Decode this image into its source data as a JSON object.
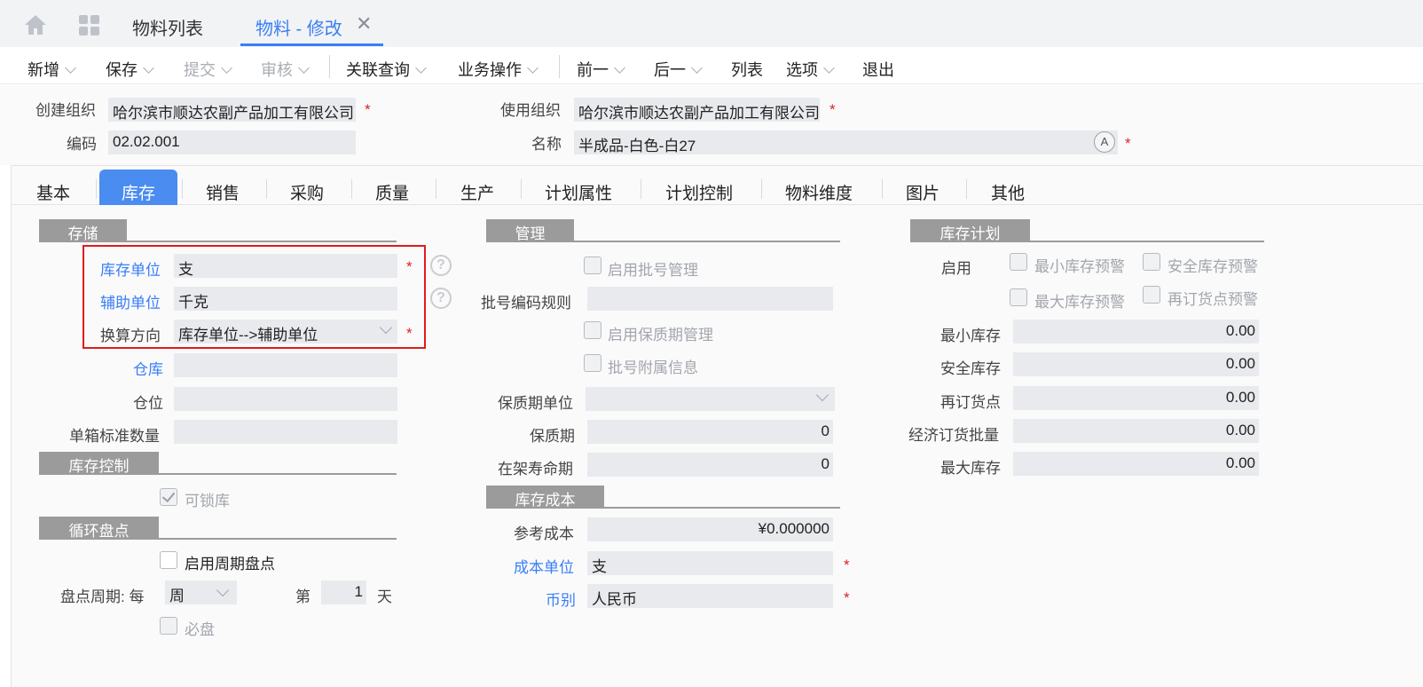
{
  "top_tabs": {
    "list": "物料列表",
    "active": "物料 - 修改",
    "close": "✕"
  },
  "toolbar": {
    "new": "新增",
    "save": "保存",
    "submit": "提交",
    "audit": "审核",
    "related_query": "关联查询",
    "business_ops": "业务操作",
    "prev": "前一",
    "next": "后一",
    "list": "列表",
    "options": "选项",
    "exit": "退出"
  },
  "header": {
    "create_org_label": "创建组织",
    "create_org_value": "哈尔滨市顺达农副产品加工有限公司",
    "use_org_label": "使用组织",
    "use_org_value": "哈尔滨市顺达农副产品加工有限公司",
    "code_label": "编码",
    "code_value": "02.02.001",
    "name_label": "名称",
    "name_value": "半成品-白色-白27",
    "required": "*",
    "accent_glyph": "A"
  },
  "tabs": [
    "基本",
    "库存",
    "销售",
    "采购",
    "质量",
    "生产",
    "计划属性",
    "计划控制",
    "物料维度",
    "图片",
    "其他"
  ],
  "storage": {
    "title": "存储",
    "stock_unit_label": "库存单位",
    "stock_unit_value": "支",
    "aux_unit_label": "辅助单位",
    "aux_unit_value": "千克",
    "conversion_label": "换算方向",
    "conversion_value": "库存单位-->辅助单位",
    "warehouse_label": "仓库",
    "warehouse_value": "",
    "location_label": "仓位",
    "location_value": "",
    "box_qty_label": "单箱标准数量",
    "box_qty_value": "",
    "help": "?"
  },
  "stock_control": {
    "title": "库存控制",
    "lockable_label": "可锁库",
    "lockable_checked": true
  },
  "cycle_count": {
    "title": "循环盘点",
    "enable_label": "启用周期盘点",
    "period_label": "盘点周期: 每",
    "period_value": "周",
    "nth_label": "第",
    "nth_value": "1",
    "day_label": "天",
    "must_label": "必盘"
  },
  "management": {
    "title": "管理",
    "batch_mgmt_label": "启用批号管理",
    "batch_rule_label": "批号编码规则",
    "batch_rule_value": "",
    "shelf_mgmt_label": "启用保质期管理",
    "batch_attach_label": "批号附属信息",
    "shelf_unit_label": "保质期单位",
    "shelf_unit_value": "",
    "shelf_life_label": "保质期",
    "shelf_life_value": "0",
    "on_shelf_label": "在架寿命期",
    "on_shelf_value": "0"
  },
  "stock_cost": {
    "title": "库存成本",
    "ref_cost_label": "参考成本",
    "ref_cost_value": "¥0.000000",
    "cost_unit_label": "成本单位",
    "cost_unit_value": "支",
    "currency_label": "币别",
    "currency_value": "人民币"
  },
  "stock_plan": {
    "title": "库存计划",
    "enable_label": "启用",
    "min_alert_label": "最小库存预警",
    "safe_alert_label": "安全库存预警",
    "max_alert_label": "最大库存预警",
    "reorder_alert_label": "再订货点预警",
    "min_stock_label": "最小库存",
    "min_stock_value": "0.00",
    "safe_stock_label": "安全库存",
    "safe_stock_value": "0.00",
    "reorder_label": "再订货点",
    "reorder_value": "0.00",
    "eoq_label": "经济订货批量",
    "eoq_value": "0.00",
    "max_stock_label": "最大库存",
    "max_stock_value": "0.00"
  }
}
